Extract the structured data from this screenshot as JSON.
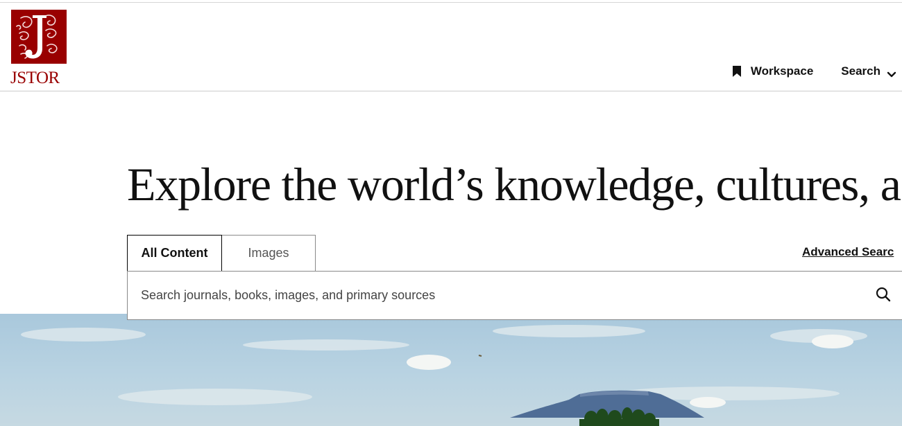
{
  "brand": {
    "logo_text": "JSTOR",
    "logo_icon": "jstor-logo-mark",
    "brand_color": "#990000"
  },
  "nav": {
    "workspace_label": "Workspace",
    "workspace_icon": "bookmark-icon",
    "search_label": "Search",
    "search_icon": "chevron-down-icon"
  },
  "hero": {
    "title": "Explore the world’s knowledge, cultures, a"
  },
  "search": {
    "tabs": [
      {
        "label": "All Content",
        "active": true
      },
      {
        "label": "Images",
        "active": false
      }
    ],
    "advanced_label": "Advanced Searc",
    "placeholder": "Search journals, books, images, and primary sources",
    "value": "",
    "submit_icon": "search-icon"
  },
  "colors": {
    "accent": "#990000",
    "text": "#111111",
    "border": "#888888",
    "sky": "#a9c8dc",
    "mesa": "#4f6d96",
    "trees": "#1f4a1d"
  }
}
